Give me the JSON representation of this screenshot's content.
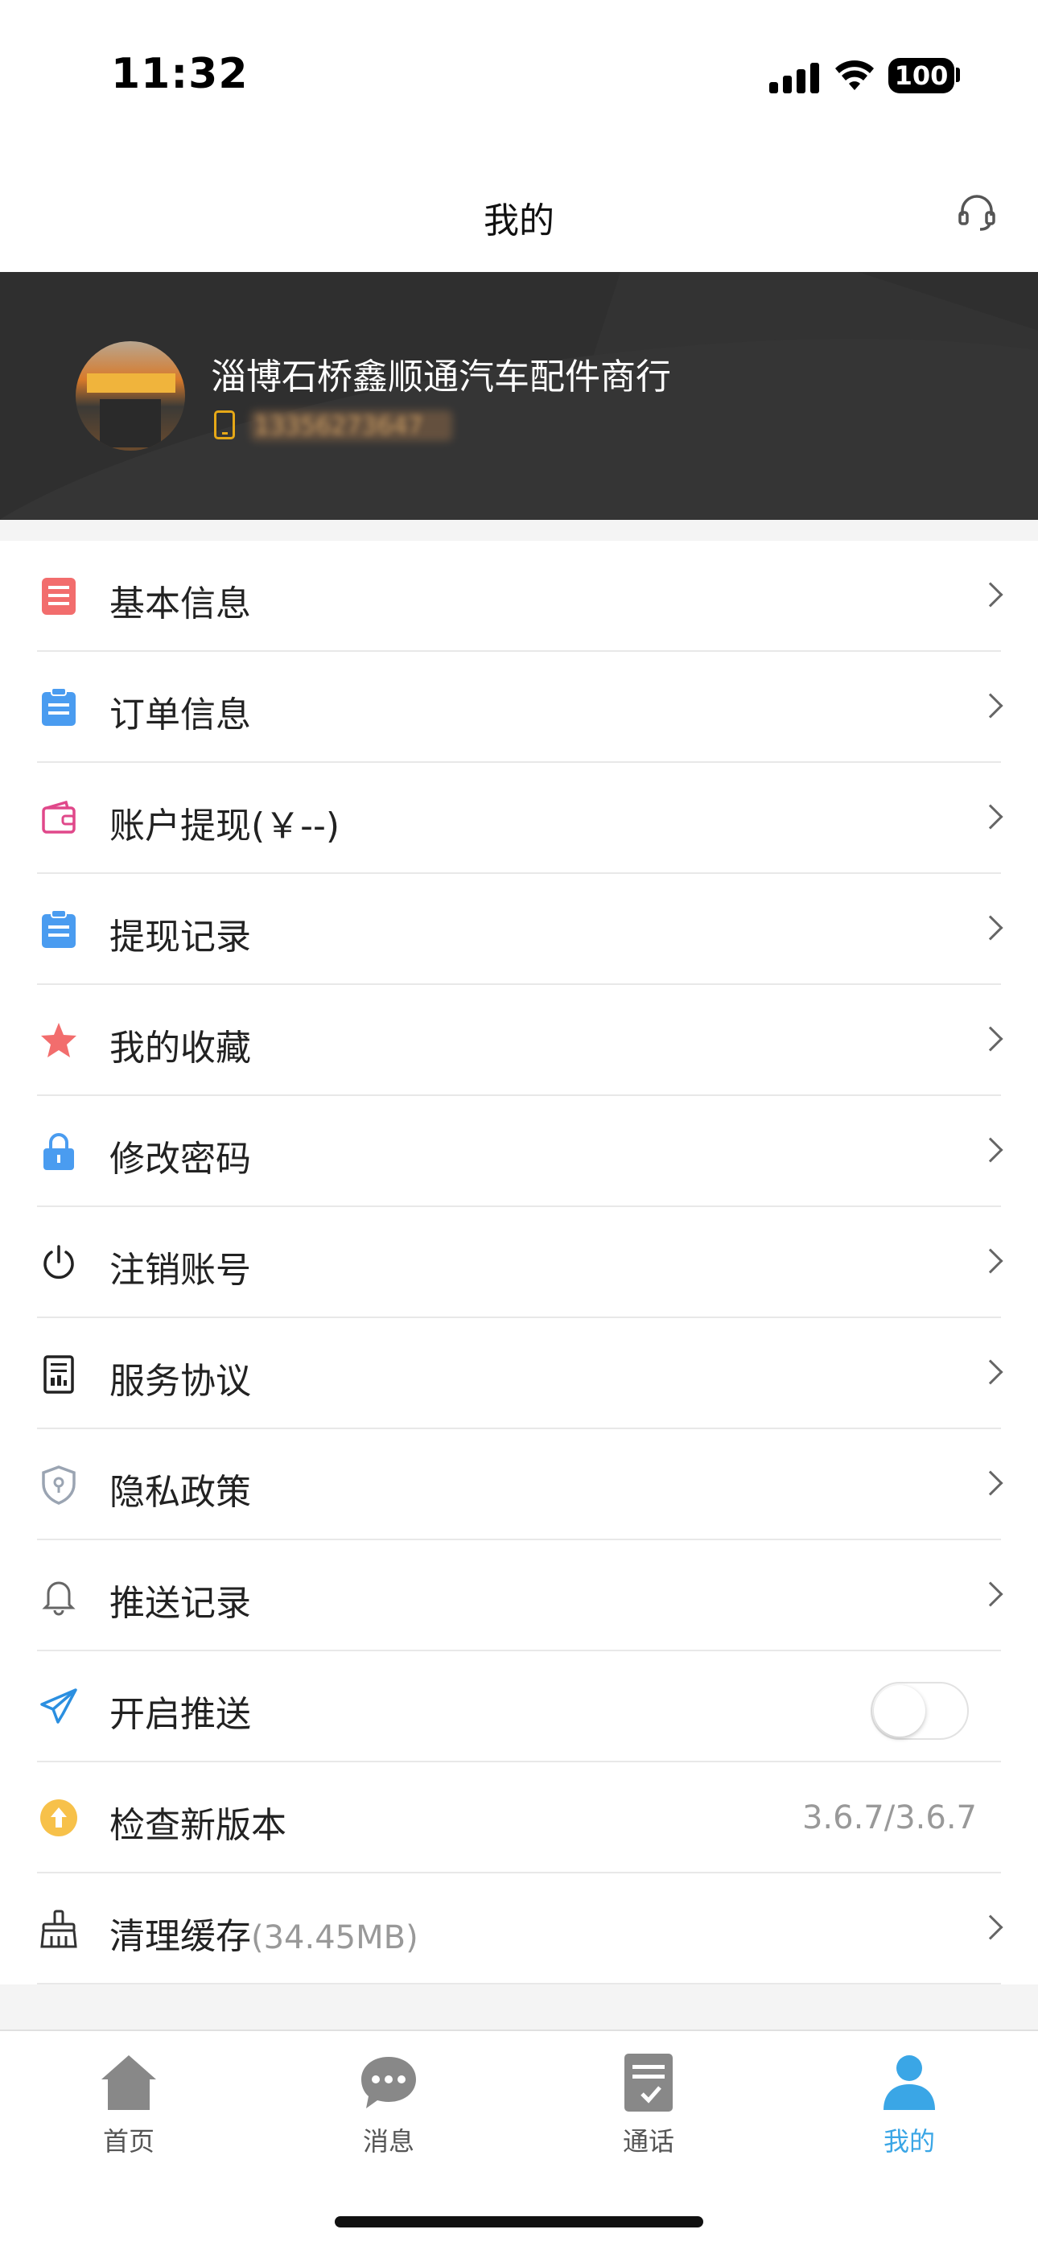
{
  "status_bar": {
    "time": "11:32",
    "battery": "100"
  },
  "nav": {
    "title": "我的"
  },
  "profile": {
    "store_name": "淄博石桥鑫顺通汽车配件商行",
    "phone_masked": "13356273647"
  },
  "menu": {
    "items": [
      {
        "label": "基本信息",
        "icon": "document-icon",
        "color": "#f26d6d"
      },
      {
        "label": "订单信息",
        "icon": "clipboard-icon",
        "color": "#4a9cf0"
      },
      {
        "label": "账户提现(￥--)",
        "icon": "wallet-icon",
        "color": "#e0488a"
      },
      {
        "label": "提现记录",
        "icon": "clipboard-icon",
        "color": "#4a9cf0"
      },
      {
        "label": "我的收藏",
        "icon": "star-icon",
        "color": "#f26d6d"
      },
      {
        "label": "修改密码",
        "icon": "lock-icon",
        "color": "#4a9cf0"
      },
      {
        "label": "注销账号",
        "icon": "power-icon",
        "color": "#222222"
      },
      {
        "label": "服务协议",
        "icon": "agreement-icon",
        "color": "#222222"
      },
      {
        "label": "隐私政策",
        "icon": "shield-icon",
        "color": "#9aa4b2"
      },
      {
        "label": "推送记录",
        "icon": "bell-icon",
        "color": "#666666"
      }
    ],
    "push_toggle": {
      "label": "开启推送",
      "icon": "paper-plane-icon",
      "enabled": false
    },
    "version": {
      "label": "检查新版本",
      "value": "3.6.7/3.6.7"
    },
    "cache": {
      "label": "清理缓存",
      "size": "(34.45MB)"
    }
  },
  "tab_bar": {
    "tabs": [
      {
        "label": "首页",
        "icon": "home-icon"
      },
      {
        "label": "消息",
        "icon": "chat-icon"
      },
      {
        "label": "通话",
        "icon": "call-log-icon"
      },
      {
        "label": "我的",
        "icon": "user-icon",
        "active": true
      }
    ],
    "active_color": "#3aa6e6"
  }
}
